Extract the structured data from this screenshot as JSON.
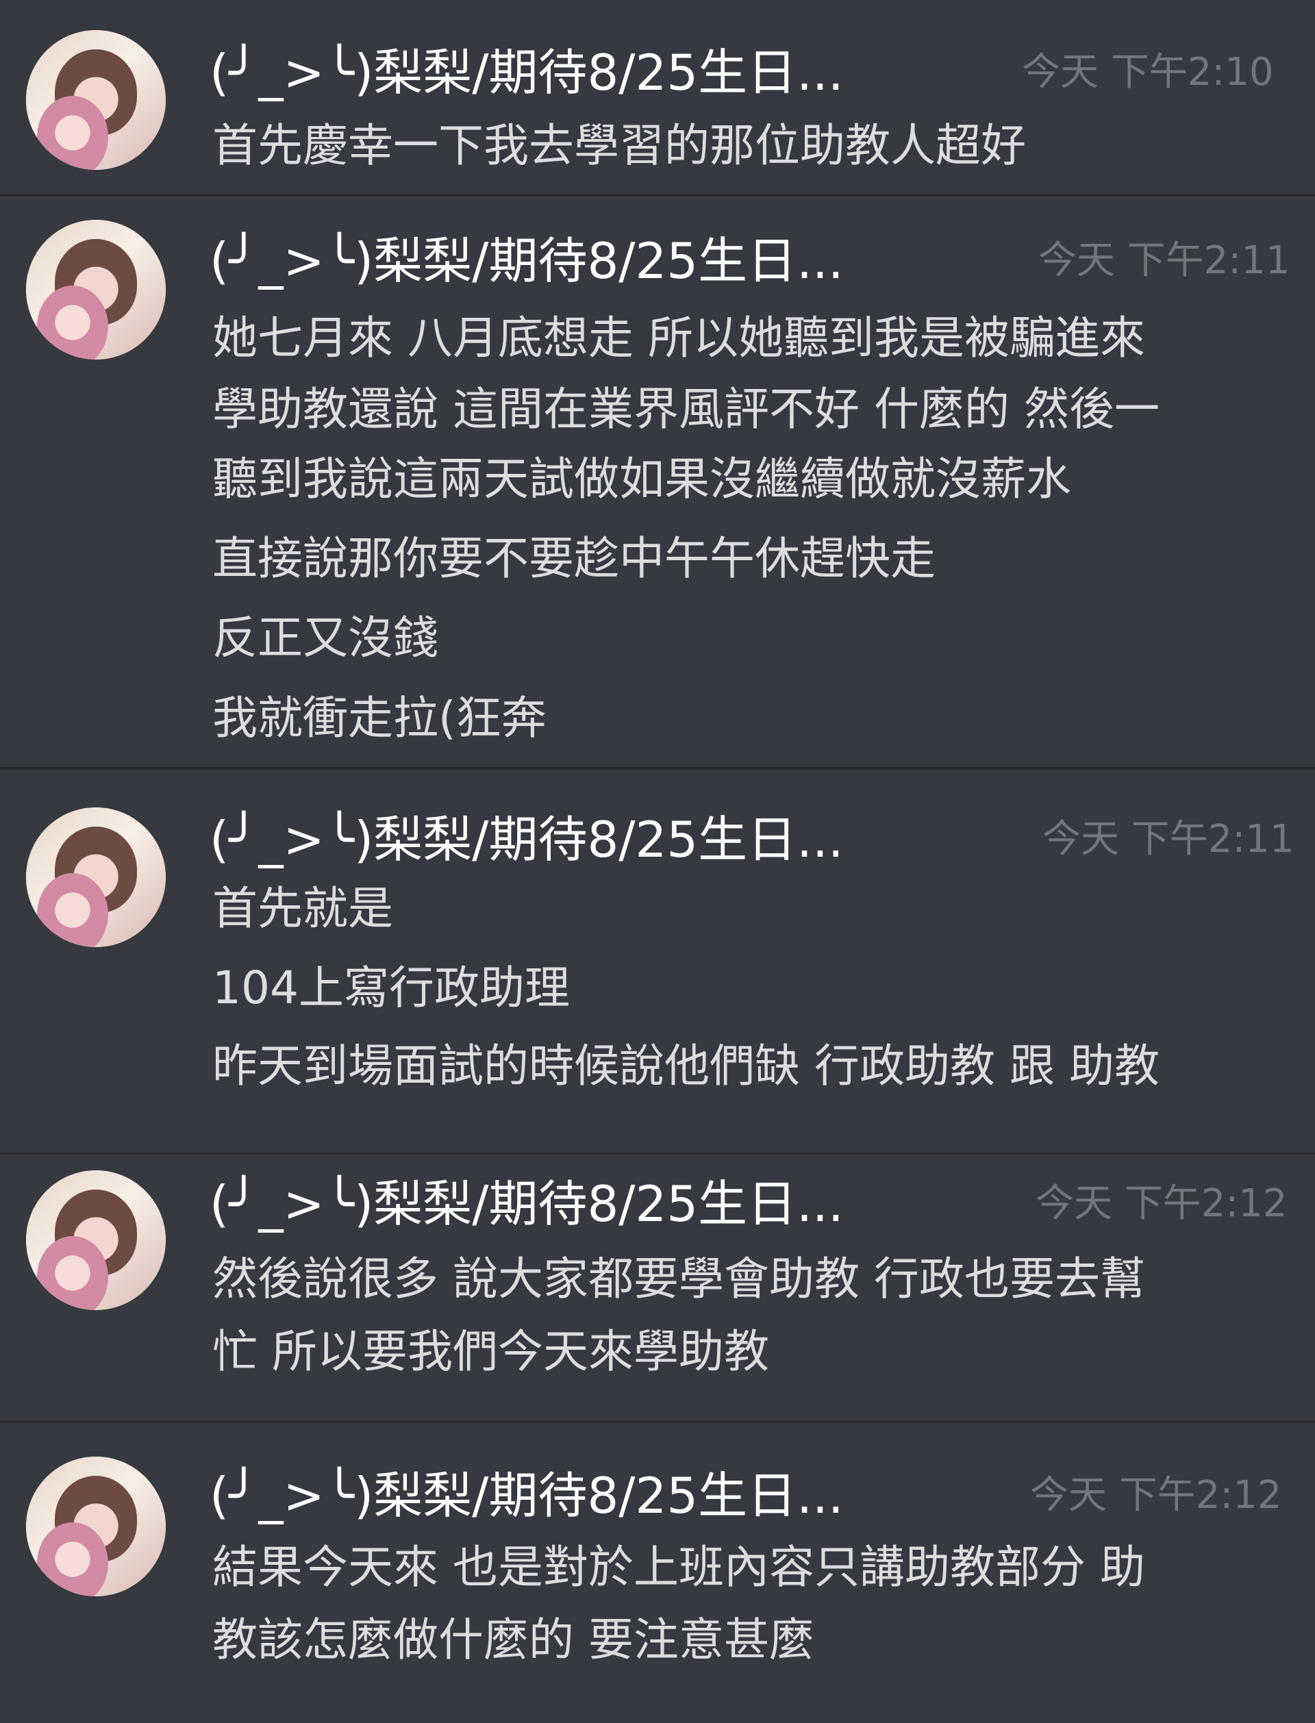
{
  "messages": [
    {
      "username": "(╯_>╰)梨梨/期待8/25生日...",
      "timestamp": "今天 下午2:10",
      "lines": [
        "首先慶幸一下我去學習的那位助教人超好"
      ]
    },
    {
      "username": "(╯_>╰)梨梨/期待8/25生日...",
      "timestamp": "今天 下午2:11",
      "lines": [
        "她七月來 八月底想走 所以她聽到我是被騙進來",
        "學助教還說 這間在業界風評不好 什麼的 然後一",
        "聽到我說這兩天試做如果沒繼續做就沒薪水",
        "直接說那你要不要趁中午午休趕快走",
        "反正又沒錢",
        "我就衝走拉(狂奔"
      ]
    },
    {
      "username": "(╯_>╰)梨梨/期待8/25生日...",
      "timestamp": "今天 下午2:11",
      "lines": [
        "首先就是",
        "104上寫行政助理",
        "昨天到場面試的時候說他們缺 行政助教 跟 助教"
      ]
    },
    {
      "username": "(╯_>╰)梨梨/期待8/25生日...",
      "timestamp": "今天 下午2:12",
      "lines": [
        "然後說很多 說大家都要學會助教 行政也要去幫",
        "忙 所以要我們今天來學助教"
      ]
    },
    {
      "username": "(╯_>╰)梨梨/期待8/25生日...",
      "timestamp": "今天 下午2:12",
      "lines": [
        "結果今天來 也是對於上班內容只講助教部分 助",
        "教該怎麼做什麼的 要注意甚麼"
      ]
    }
  ]
}
